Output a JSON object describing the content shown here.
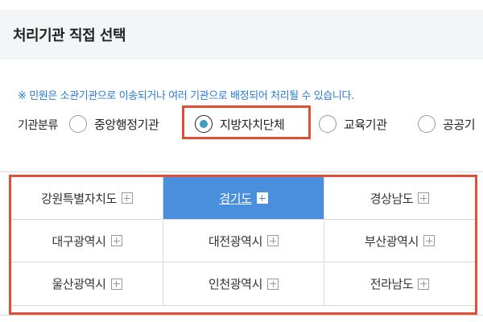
{
  "header": {
    "title": "처리기관 직접 선택"
  },
  "notice": "※ 민원은 소관기관으로 이송되거나 여러 기관으로 배정되어 처리될 수 있습니다.",
  "filter": {
    "label": "기관분류",
    "options": [
      {
        "label": "중앙행정기관",
        "selected": false
      },
      {
        "label": "지방자치단체",
        "selected": true
      },
      {
        "label": "교육기관",
        "selected": false
      },
      {
        "label": "공공기",
        "selected": false
      }
    ]
  },
  "regions": [
    {
      "label": "강원특별자치도",
      "active": false
    },
    {
      "label": "경기도",
      "active": true
    },
    {
      "label": "경상남도",
      "active": false
    },
    {
      "label": "대구광역시",
      "active": false
    },
    {
      "label": "대전광역시",
      "active": false
    },
    {
      "label": "부산광역시",
      "active": false
    },
    {
      "label": "울산광역시",
      "active": false
    },
    {
      "label": "인천광역시",
      "active": false
    },
    {
      "label": "전라남도",
      "active": false
    }
  ],
  "colors": {
    "accent": "#4a8fdc",
    "notice_text": "#2a7bd6",
    "highlight": "#e14f36",
    "radio_selected": "#3a9fc2"
  },
  "icons": {
    "region_expand": "plus-box-icon"
  }
}
